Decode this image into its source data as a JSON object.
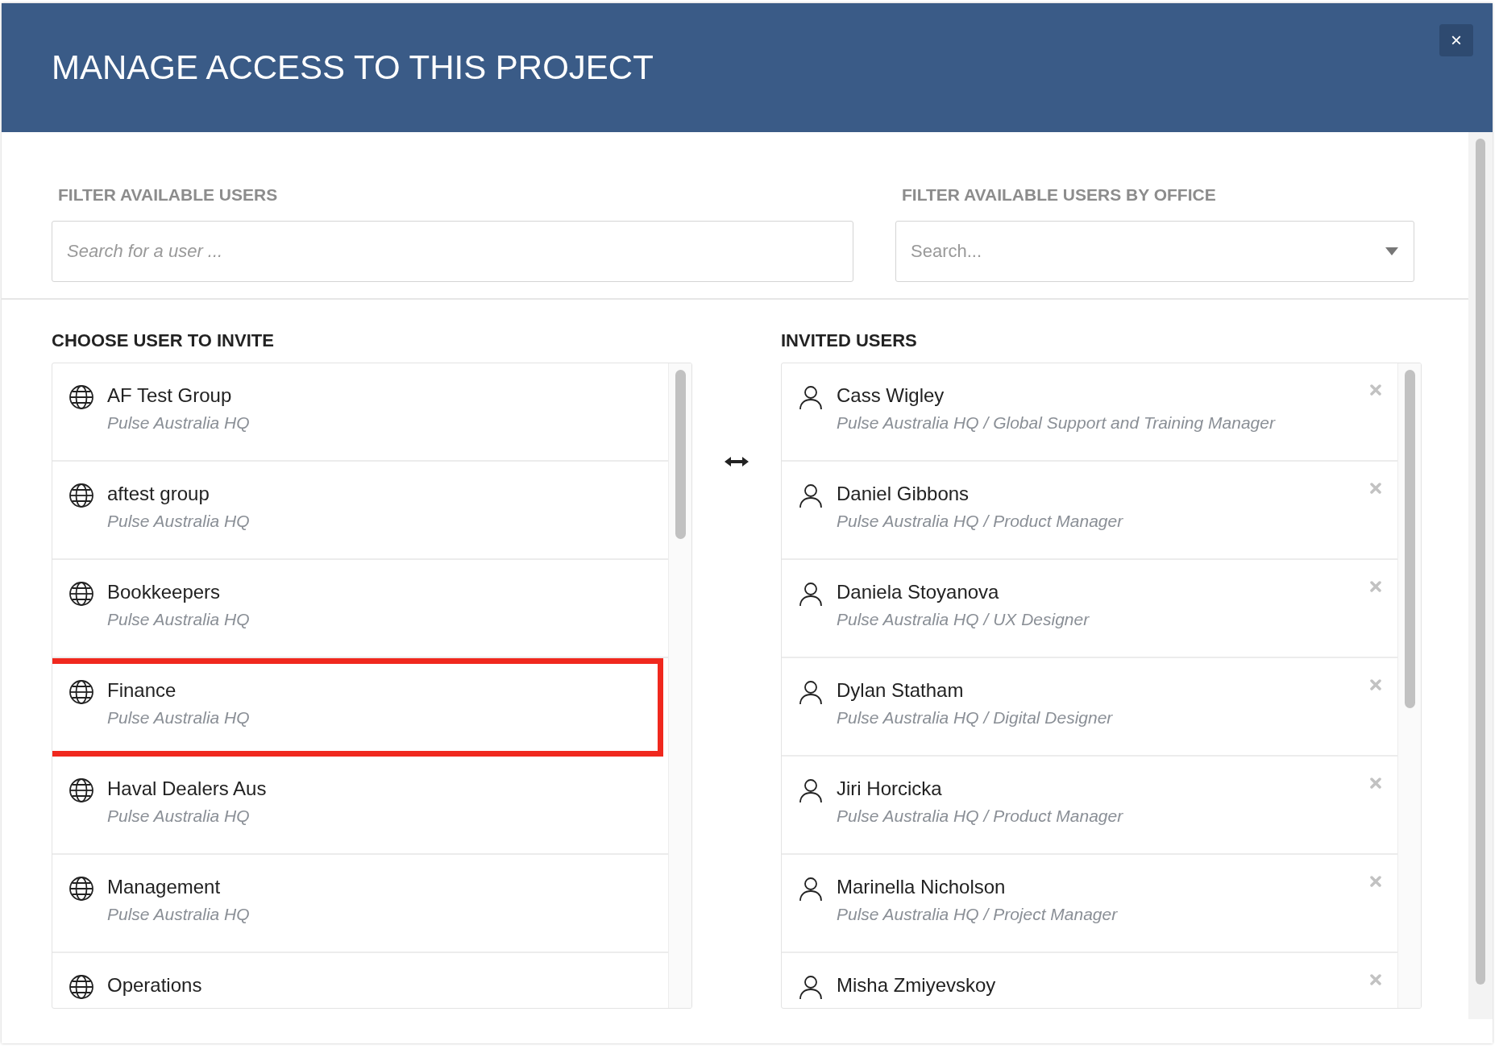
{
  "dialog": {
    "title": "MANAGE ACCESS TO THIS PROJECT",
    "close": "×"
  },
  "filters": [
    {
      "label": "FILTER AVAILABLE USERS",
      "placeholder": "Search for a user ...",
      "kind": "text"
    },
    {
      "label": "FILTER AVAILABLE USERS BY OFFICE",
      "placeholder": "Search...",
      "kind": "select"
    }
  ],
  "available": {
    "title": "CHOOSE USER TO INVITE",
    "items": [
      {
        "name": "AF Test Group",
        "office": "Pulse Australia HQ",
        "highlighted": false
      },
      {
        "name": "aftest group",
        "office": "Pulse Australia HQ",
        "highlighted": false
      },
      {
        "name": "Bookkeepers",
        "office": "Pulse Australia HQ",
        "highlighted": false
      },
      {
        "name": "Finance",
        "office": "Pulse Australia HQ",
        "highlighted": true
      },
      {
        "name": "Haval Dealers Aus",
        "office": "Pulse Australia HQ",
        "highlighted": false
      },
      {
        "name": "Management",
        "office": "Pulse Australia HQ",
        "highlighted": false
      },
      {
        "name": "Operations",
        "highlighted": false
      }
    ]
  },
  "invited": {
    "title": "INVITED USERS",
    "items": [
      {
        "name": "Cass Wigley",
        "detail": "Pulse Australia HQ / Global Support and Training Manager"
      },
      {
        "name": "Daniel Gibbons",
        "detail": "Pulse Australia HQ / Product Manager"
      },
      {
        "name": "Daniela Stoyanova",
        "detail": "Pulse Australia HQ / UX Designer"
      },
      {
        "name": "Dylan Statham",
        "detail": "Pulse Australia HQ / Digital Designer"
      },
      {
        "name": "Jiri Horcicka",
        "detail": "Pulse Australia HQ / Product Manager"
      },
      {
        "name": "Marinella Nicholson",
        "detail": "Pulse Australia HQ / Project Manager"
      },
      {
        "name": "Misha Zmiyevskoy"
      }
    ]
  }
}
